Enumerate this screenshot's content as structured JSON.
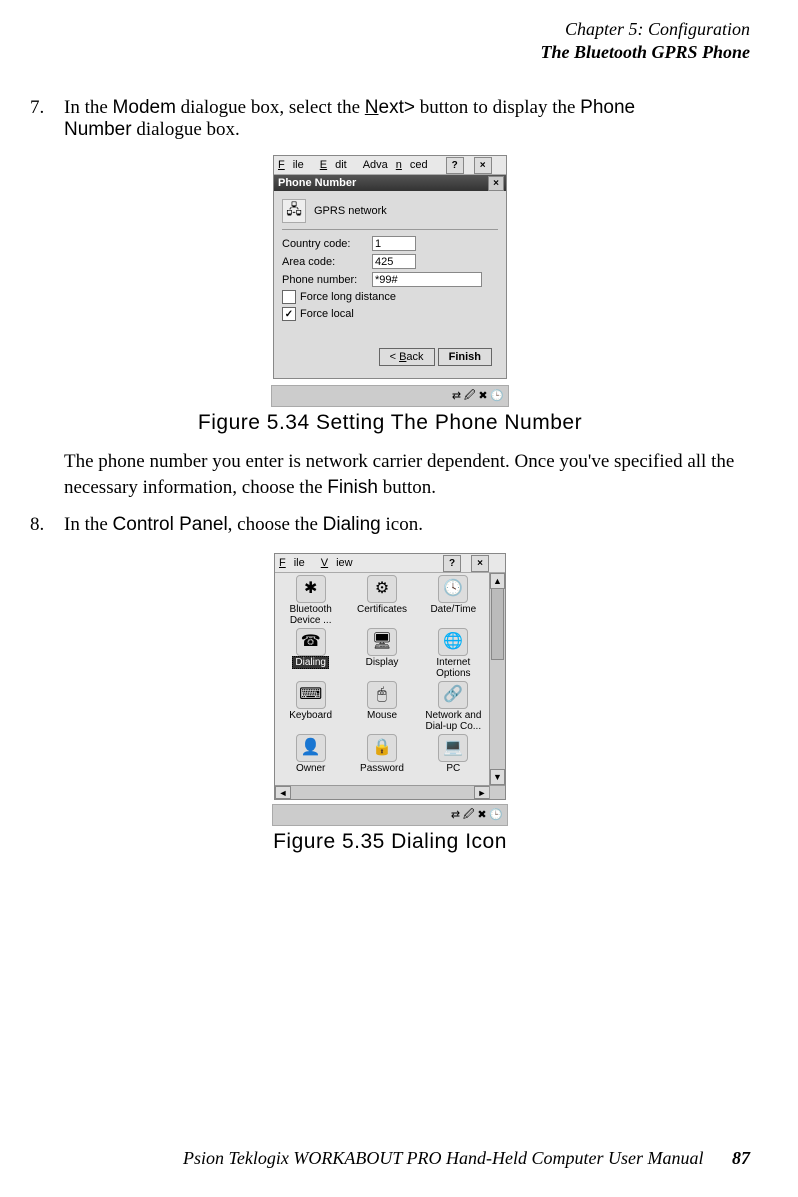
{
  "header": {
    "chapter": "Chapter 5: Configuration",
    "section": "The Bluetooth GPRS Phone"
  },
  "step7": {
    "num": "7.",
    "t1": "In the ",
    "modem": "Modem",
    "t2": " dialogue box, select the ",
    "next_u": "N",
    "next_rest": "ext>",
    "t3": " button to display the ",
    "phone": "Phone",
    "number": "Number",
    "t4": " dialogue box."
  },
  "fig1": {
    "caption": "Figure 5.34 Setting The Phone Number",
    "menu": {
      "file_u": "F",
      "file": "ile",
      "edit_u": "E",
      "edit": "dit",
      "adv": "Adva",
      "adv_u": "n",
      "adv2": "ced"
    },
    "help": "?",
    "close": "×",
    "title": "Phone Number",
    "netname": "GPRS network",
    "lbl_country": "Country code:",
    "lbl_area": "Area code:",
    "lbl_phone": "Phone number:",
    "val_country": "1",
    "val_area": "425",
    "val_phone": "*99#",
    "chk_long": "Force long distance",
    "chk_local": "Force local",
    "btn_back": "< Back",
    "btn_back_u": "B",
    "btn_finish": "Finish",
    "tray": "⇄ 🖉 ✖ 🕒"
  },
  "para1": {
    "t1": "The phone number you enter is network carrier dependent. Once you've specified all the necessary information, choose the ",
    "finish": "Finish",
    "t2": " button."
  },
  "step8": {
    "num": "8.",
    "t1": "In the ",
    "cp": "Control Panel",
    "t2": ", choose the ",
    "dial": "Dialing",
    "t3": " icon."
  },
  "fig2": {
    "caption": "Figure 5.35 Dialing Icon",
    "menu": {
      "file_u": "F",
      "file": "ile",
      "view_u": "V",
      "view": "iew"
    },
    "help": "?",
    "close": "×",
    "items": [
      {
        "icon": "✱",
        "label": "Bluetooth\nDevice ..."
      },
      {
        "icon": "⚙",
        "label": "Certificates"
      },
      {
        "icon": "🕓",
        "label": "Date/Time"
      },
      {
        "icon": "☎",
        "label": "Dialing",
        "selected": true
      },
      {
        "icon": "🖥",
        "label": "Display"
      },
      {
        "icon": "🌐",
        "label": "Internet\nOptions"
      },
      {
        "icon": "⌨",
        "label": "Keyboard"
      },
      {
        "icon": "🖱",
        "label": "Mouse"
      },
      {
        "icon": "🔗",
        "label": "Network and\nDial-up Co..."
      },
      {
        "icon": "👤",
        "label": "Owner"
      },
      {
        "icon": "🔒",
        "label": "Password"
      },
      {
        "icon": "💻",
        "label": "PC"
      }
    ],
    "tray": "⇄ 🖉 ✖ 🕒"
  },
  "footer": {
    "text": "Psion Teklogix WORKABOUT PRO Hand-Held Computer User Manual",
    "page": "87"
  }
}
